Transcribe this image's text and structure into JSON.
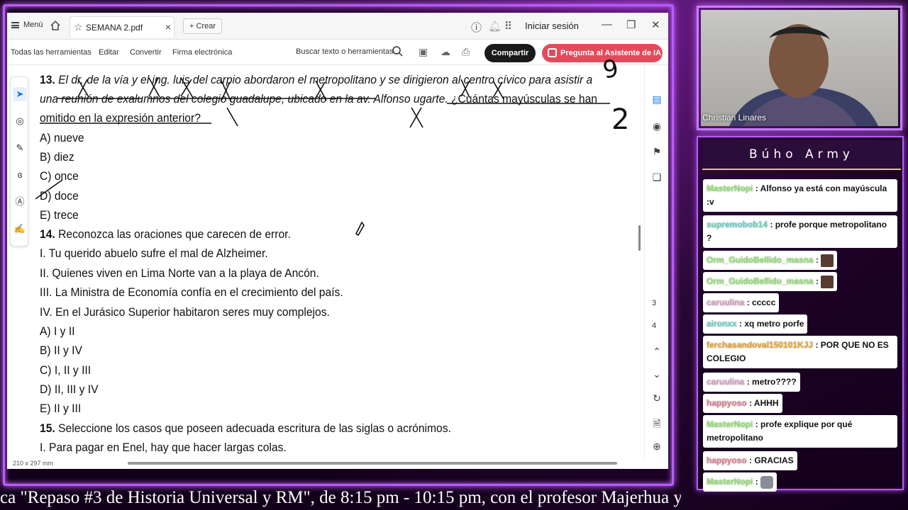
{
  "titlebar": {
    "menu_label": "Menú",
    "tab_name": "SEMANA 2.pdf",
    "create_label": "+ Crear",
    "signin_label": "Iniciar sesión"
  },
  "toolbar": {
    "items": [
      "Todas las herramientas",
      "Editar",
      "Convertir",
      "Firma electrónica"
    ],
    "search_placeholder": "Buscar texto o herramientas",
    "share_label": "Compartir",
    "ai_label": "Pregunta al Asistente de IA"
  },
  "document": {
    "q13_line1_num": "13.",
    "q13_line1": "El dr. de la vía y el ing. luis del carpio abordaron el metropolitano y se dirigieron al centro cívico para asistir a",
    "q13_line2": "una reunión de exalumnos del colegio guadalupe, ubicado en la av. Alfonso ugarte.",
    "q13_line2b": " ¿Cuántas mayúsculas se han",
    "q13_line3": "omitido en la expresión anterior?",
    "q13_options": [
      "A) nueve",
      "B) diez",
      "C) once",
      "D) doce",
      "E) trece"
    ],
    "q14_num": "14.",
    "q14_text": "Reconozca las oraciones que carecen de error.",
    "q14_items": [
      "I. Tu querido abuelo sufre el mal de Alzheimer.",
      "II. Quienes viven en Lima Norte van a la playa de Ancón.",
      "III. La Ministra de Economía confía en el crecimiento del país.",
      "IV. En el Jurásico Superior habitaron seres muy complejos."
    ],
    "q14_options": [
      "A) I y II",
      "B) II y IV",
      "C) I, II y III",
      "D) II, III y IV",
      "E) II y III"
    ],
    "q15_num": "15.",
    "q15_text": "Seleccione los casos que poseen adecuada escritura de las siglas o acrónimos.",
    "q15_items": [
      "I. Para pagar en Enel, hay que hacer largas colas."
    ],
    "annotation_2": "2",
    "annotation_9": "9"
  },
  "rail": {
    "page_current": "3",
    "page_next": "4"
  },
  "status": {
    "page_size": "210 x 297 mm"
  },
  "webcam": {
    "name": "Christian Linares"
  },
  "chat": {
    "title": "Búho Army",
    "messages": [
      {
        "user": "MasterNopi",
        "color": "#8ee06a",
        "text": ": Alfonso ya está con mayúscula :v"
      },
      {
        "user": "supremobob14",
        "color": "#5fd6c8",
        "text": ": profe porque metropolitano ?"
      },
      {
        "user": "Orm_GuidoBellido_masna",
        "color": "#8ee06a",
        "text": ":"
      },
      {
        "user": "Orm_GuidoBellido_masna",
        "color": "#8ee06a",
        "text": ":"
      },
      {
        "user": "caruulina",
        "color": "#d99ac4",
        "text": ": ccccc"
      },
      {
        "user": "aironxx",
        "color": "#5fd6c8",
        "text": ": xq metro porfe"
      },
      {
        "user": "ferchasandoval150101KJJ",
        "color": "#f0a020",
        "text": ": POR QUE NO ES COLEGIO"
      },
      {
        "user": "caruulina",
        "color": "#d99ac4",
        "text": ": metro????"
      },
      {
        "user": "happyoso",
        "color": "#e07a8c",
        "text": ": AHHH"
      },
      {
        "user": "MasterNopi",
        "color": "#8ee06a",
        "text": ": profe explique por qué metropolitano"
      },
      {
        "user": "happyoso",
        "color": "#e07a8c",
        "text": ": GRACIAS"
      },
      {
        "user": "MasterNopi",
        "color": "#8ee06a",
        "text": ":"
      }
    ]
  },
  "ticker": {
    "text": "ca \"Repaso #3 de Historia Universal y RM\", de 8:15 pm - 10:15 pm, con el profesor Majerhua y C"
  },
  "colors": {
    "frame": "#b95bff",
    "ai_button": "#e34b5b",
    "share_button": "#1a1a1a"
  }
}
